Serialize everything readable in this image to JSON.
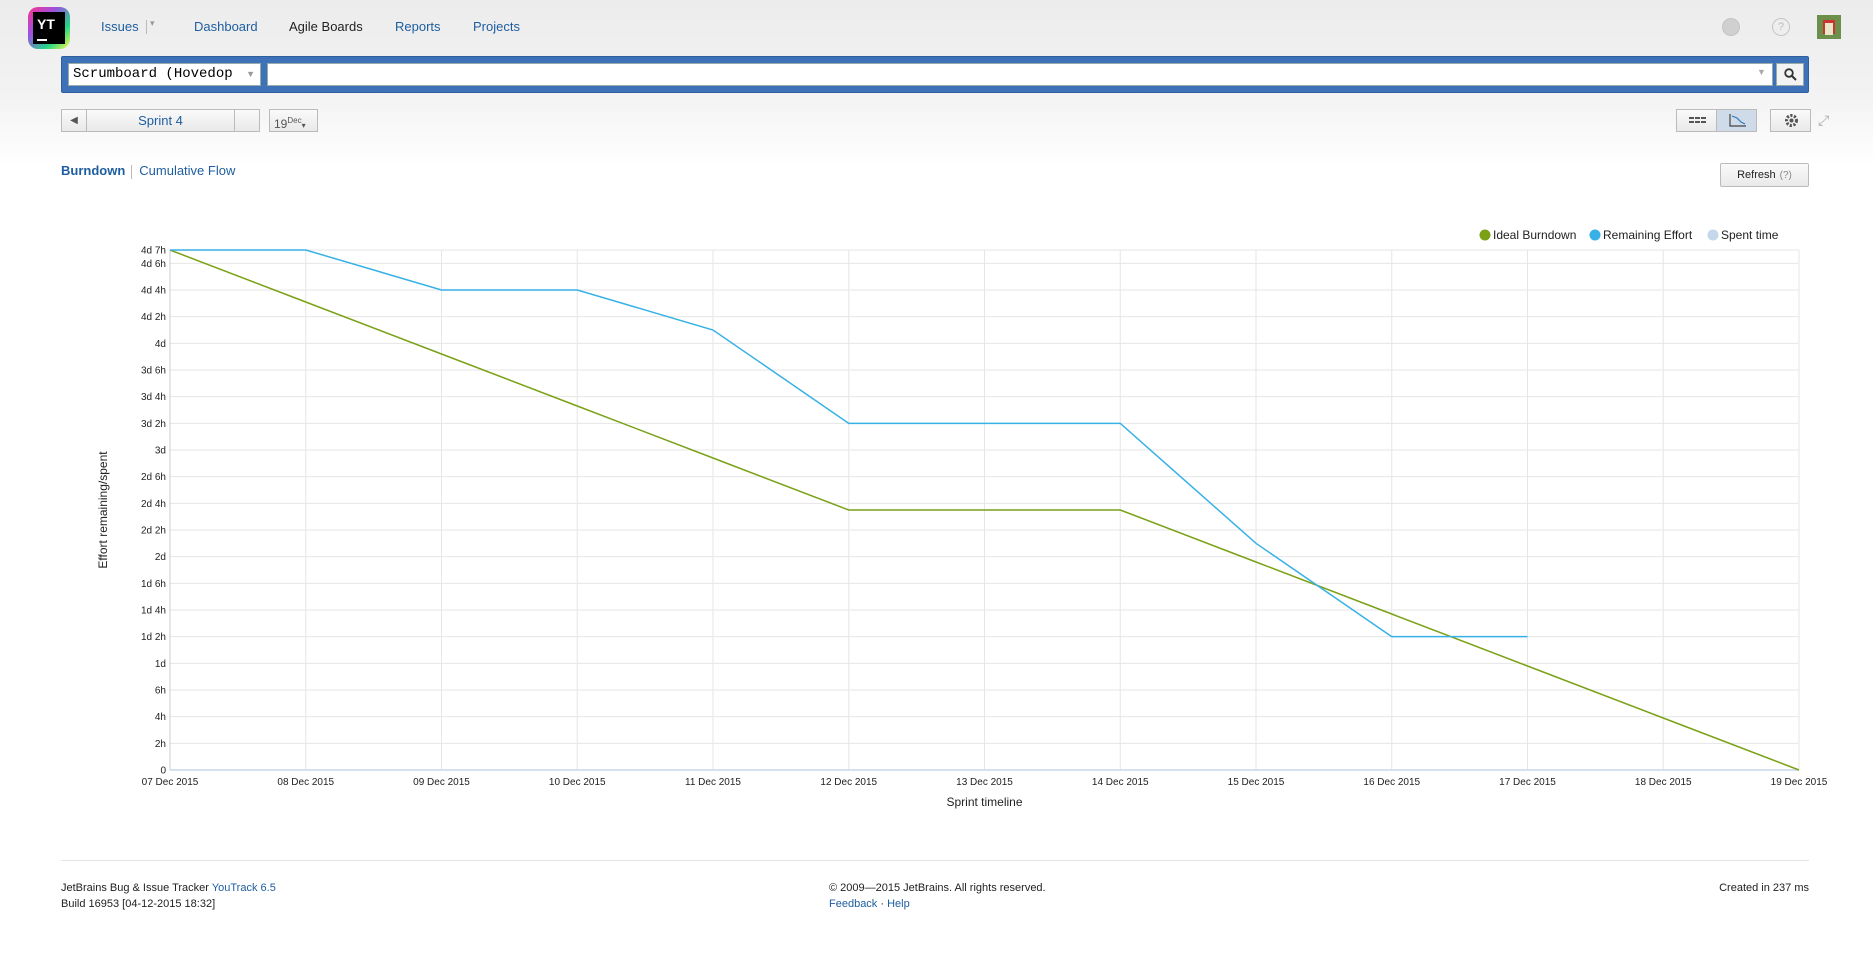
{
  "header": {
    "logo_text": "YT",
    "nav": {
      "issues": "Issues",
      "dashboard": "Dashboard",
      "agile_boards": "Agile Boards",
      "reports": "Reports",
      "projects": "Projects"
    }
  },
  "search": {
    "board": "Scrumboard (Hovedop",
    "query_value": ""
  },
  "sprint": {
    "name": "Sprint 4",
    "date_day": "19",
    "date_month": "Dec"
  },
  "tabs": {
    "burndown": "Burndown",
    "cumulative_flow": "Cumulative Flow"
  },
  "refresh": {
    "label": "Refresh",
    "hint": "(?)"
  },
  "chart_data": {
    "type": "line",
    "title": "",
    "xlabel": "Sprint timeline",
    "ylabel": "Effort remaining/spent",
    "x": [
      "07 Dec 2015",
      "08 Dec 2015",
      "09 Dec 2015",
      "10 Dec 2015",
      "11 Dec 2015",
      "12 Dec 2015",
      "13 Dec 2015",
      "14 Dec 2015",
      "15 Dec 2015",
      "16 Dec 2015",
      "17 Dec 2015",
      "18 Dec 2015",
      "19 Dec 2015"
    ],
    "y_ticks": [
      {
        "label": "0",
        "value": 0
      },
      {
        "label": "2h",
        "value": 2
      },
      {
        "label": "4h",
        "value": 4
      },
      {
        "label": "6h",
        "value": 6
      },
      {
        "label": "1d",
        "value": 8
      },
      {
        "label": "1d 2h",
        "value": 10
      },
      {
        "label": "1d 4h",
        "value": 12
      },
      {
        "label": "1d 6h",
        "value": 14
      },
      {
        "label": "2d",
        "value": 16
      },
      {
        "label": "2d 2h",
        "value": 18
      },
      {
        "label": "2d 4h",
        "value": 20
      },
      {
        "label": "2d 6h",
        "value": 22
      },
      {
        "label": "3d",
        "value": 24
      },
      {
        "label": "3d 2h",
        "value": 26
      },
      {
        "label": "3d 4h",
        "value": 28
      },
      {
        "label": "3d 6h",
        "value": 30
      },
      {
        "label": "4d",
        "value": 32
      },
      {
        "label": "4d 2h",
        "value": 34
      },
      {
        "label": "4d 4h",
        "value": 36
      },
      {
        "label": "4d 6h",
        "value": 38
      },
      {
        "label": "4d 7h",
        "value": 39
      }
    ],
    "ylim": [
      0,
      39
    ],
    "unit": "hours (1d = 8h)",
    "legend_position": "top-right",
    "grid": true,
    "series": [
      {
        "name": "Ideal Burndown",
        "color": "#7aa116",
        "points": [
          [
            0,
            39
          ],
          [
            1,
            35.1
          ],
          [
            2,
            31.2
          ],
          [
            3,
            27.3
          ],
          [
            4,
            23.4
          ],
          [
            5,
            19.5
          ],
          [
            6,
            19.5
          ],
          [
            7,
            19.5
          ],
          [
            8,
            15.6
          ],
          [
            9,
            11.7
          ],
          [
            10,
            7.8
          ],
          [
            11,
            3.9
          ],
          [
            12,
            0
          ]
        ]
      },
      {
        "name": "Remaining Effort",
        "color": "#37b1e6",
        "points": [
          [
            0,
            39
          ],
          [
            1,
            39
          ],
          [
            2,
            36
          ],
          [
            3,
            36
          ],
          [
            4,
            33
          ],
          [
            5,
            26
          ],
          [
            6,
            26
          ],
          [
            7,
            26
          ],
          [
            8,
            17
          ],
          [
            9,
            10
          ],
          [
            10,
            10
          ]
        ]
      },
      {
        "name": "Spent time",
        "color": "#c5d7ea",
        "points": []
      }
    ]
  },
  "footer": {
    "left_prefix": "JetBrains Bug & Issue Tracker",
    "product_link": "YouTrack 6.5",
    "build": "Build 16953 [04-12-2015 18:32]",
    "copyright": "© 2009—2015 JetBrains. All rights reserved.",
    "feedback": "Feedback",
    "help": "Help",
    "created": "Created in 237 ms"
  }
}
